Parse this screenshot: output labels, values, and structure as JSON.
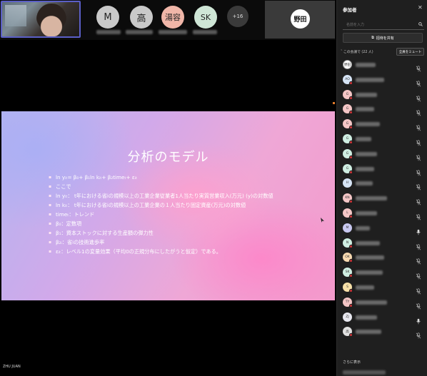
{
  "top_strip": {
    "participants": [
      {
        "initial": "M",
        "color": "#c9c9c9"
      },
      {
        "initial": "高",
        "color": "#c9c9c9"
      },
      {
        "initial": "湯容",
        "color": "#f0b6a8"
      },
      {
        "initial": "SK",
        "color": "#cfe6d6"
      }
    ],
    "more_count": "+16",
    "active_speaker": "野田"
  },
  "slide": {
    "title": "分析のモデル",
    "bullets": [
      "ln yᵢₜ= β₀+ β₁ln kᵢₜ+ β₂timeₜ+ εᵢₜ",
      "ここで",
      "ln yᵢₜ： t年における省iの規模以上の工業企業従業者1人当たり実質営業収入(万元) (y)の対数値",
      "ln kᵢₜ： t年における省iの規模以上の工業企業の１人当たり固定資産(万元)の対数値",
      "timeₜ：トレンド",
      "β₀：定数項",
      "β₁：資本ストックに対する生産額の弾力性",
      "β₂ᵢ：省iの技術進歩率",
      "εᵢₜ：レベル1の変量効果（平均0の正規分布にしたがうと仮定）である。"
    ],
    "presenter": "ZHU JUAN"
  },
  "panel": {
    "title": "参加者",
    "search_placeholder": "名前を入力",
    "share_invite": "招待を共有",
    "section_header": "ˇ この会議で (22 人)",
    "mute_all": "全員をミュート",
    "show_more": "さらに表示",
    "participants": [
      {
        "avatar": "野田",
        "color": "#ffffff",
        "mic": "muted",
        "status_dot": false
      },
      {
        "avatar": "AO",
        "color": "#d6e4f5",
        "mic": "muted",
        "status_dot": true
      },
      {
        "avatar": "G",
        "color": "#f4c6c6",
        "mic": "muted",
        "status_dot": true
      },
      {
        "avatar": "G",
        "color": "#f4c6c6",
        "mic": "muted",
        "status_dot": true
      },
      {
        "avatar": "G",
        "color": "#f4c6c6",
        "mic": "muted",
        "status_dot": true
      },
      {
        "avatar": "G",
        "color": "#cfeee2",
        "mic": "muted",
        "status_dot": true
      },
      {
        "avatar": "G",
        "color": "#cfeee2",
        "mic": "muted",
        "status_dot": true
      },
      {
        "avatar": "G",
        "color": "#cfeee2",
        "mic": "muted",
        "status_dot": true
      },
      {
        "avatar": "H",
        "color": "#d6e4f5",
        "mic": "muted",
        "status_dot": false
      },
      {
        "avatar": "KN",
        "color": "#f4c6c6",
        "mic": "muted",
        "status_dot": true
      },
      {
        "avatar": "L",
        "color": "#f4c6c6",
        "mic": "muted",
        "status_dot": true
      },
      {
        "avatar": "M",
        "color": "#c8c8f0",
        "mic": "on",
        "status_dot": false
      },
      {
        "avatar": "N",
        "color": "#cfeee2",
        "mic": "muted",
        "status_dot": true
      },
      {
        "avatar": "OK",
        "color": "#f7d9b0",
        "mic": "muted",
        "status_dot": true
      },
      {
        "avatar": "SK",
        "color": "#cfeee2",
        "mic": "muted",
        "status_dot": true
      },
      {
        "avatar": "S",
        "color": "#f7e0a8",
        "mic": "muted",
        "status_dot": true
      },
      {
        "avatar": "TY",
        "color": "#f4c6c6",
        "mic": "muted",
        "status_dot": true
      },
      {
        "avatar": "ZJ",
        "color": "#e8e8f0",
        "mic": "on",
        "status_dot": false
      },
      {
        "avatar": "高",
        "color": "#e0e0e0",
        "mic": "muted",
        "status_dot": true
      }
    ]
  }
}
